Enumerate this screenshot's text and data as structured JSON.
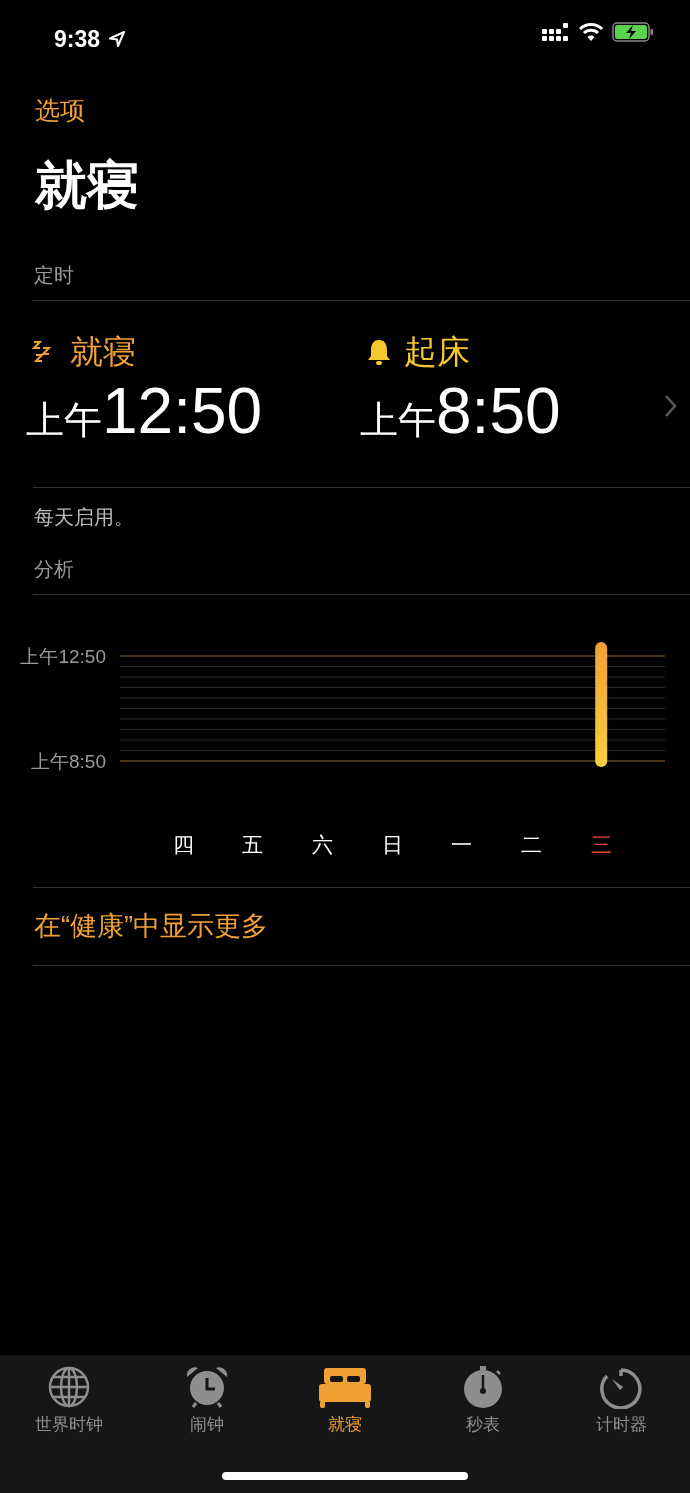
{
  "status_bar": {
    "time": "9:38",
    "location": true,
    "charging": true
  },
  "nav": {
    "back": "选项",
    "title": "就寝"
  },
  "schedule": {
    "header": "定时",
    "items": [
      {
        "kind": "bedtime",
        "label": "就寝",
        "period": "上午",
        "time": "12:50"
      },
      {
        "kind": "wakeup",
        "label": "起床",
        "period": "上午",
        "time": "8:50"
      }
    ],
    "note": "每天启用。"
  },
  "analysis": {
    "header": "分析",
    "axis_labels": [
      "上午12:50",
      "上午8:50"
    ],
    "days": [
      {
        "label": "四",
        "today": false,
        "slept": false
      },
      {
        "label": "五",
        "today": false,
        "slept": false
      },
      {
        "label": "六",
        "today": false,
        "slept": false
      },
      {
        "label": "日",
        "today": false,
        "slept": false
      },
      {
        "label": "一",
        "today": false,
        "slept": false
      },
      {
        "label": "二",
        "today": false,
        "slept": false
      },
      {
        "label": "三",
        "today": true,
        "slept": true
      }
    ]
  },
  "health_link": "在“健康”中显示更多",
  "tabs": [
    {
      "kind": "globe",
      "label": "世界时钟",
      "selected": false
    },
    {
      "kind": "alarm",
      "label": "闹钟",
      "selected": false
    },
    {
      "kind": "bed",
      "label": "就寝",
      "selected": true
    },
    {
      "kind": "stopwatch",
      "label": "秒表",
      "selected": false
    },
    {
      "kind": "timer",
      "label": "计时器",
      "selected": false
    }
  ]
}
